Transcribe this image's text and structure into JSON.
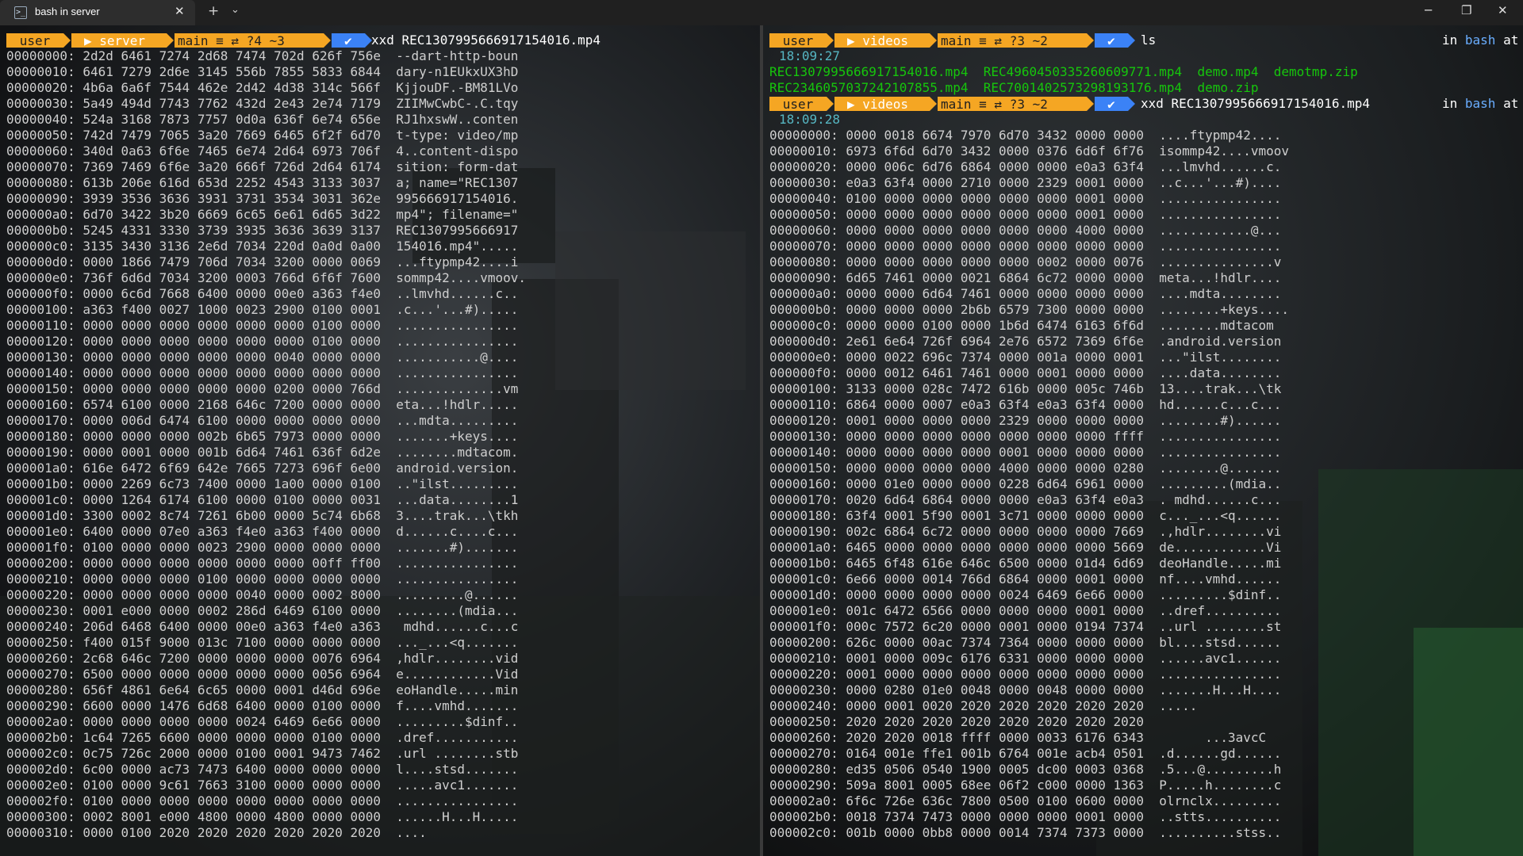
{
  "window": {
    "tab_title": "bash in server",
    "new_tab_glyph": "+",
    "tab_menu_glyph": "⌄",
    "tab_close_glyph": "✕",
    "minimize_glyph": "─",
    "maximize_glyph": "❐",
    "close_glyph": "✕"
  },
  "left": {
    "prompt": {
      "user": "user",
      "folder": "server",
      "git": "main ≡ ⇄ ?4 ~3",
      "check": "✔",
      "command": "xxd REC1307995666917154016.mp4"
    },
    "lines": [
      "00000000: 2d2d 6461 7274 2d68 7474 702d 626f 756e  --dart-http-boun",
      "00000010: 6461 7279 2d6e 3145 556b 7855 5833 6844  dary-n1EUkxUX3hD",
      "00000020: 4b6a 6a6f 7544 462e 2d42 4d38 314c 566f  KjjouDF.-BM81LVo",
      "00000030: 5a49 494d 7743 7762 432d 2e43 2e74 7179  ZIIMwCwbC-.C.tqy",
      "00000040: 524a 3168 7873 7757 0d0a 636f 6e74 656e  RJ1hxswW..conten",
      "00000050: 742d 7479 7065 3a20 7669 6465 6f2f 6d70  t-type: video/mp",
      "00000060: 340d 0a63 6f6e 7465 6e74 2d64 6973 706f  4..content-dispo",
      "00000070: 7369 7469 6f6e 3a20 666f 726d 2d64 6174  sition: form-dat",
      "00000080: 613b 206e 616d 653d 2252 4543 3133 3037  a; name=\"REC1307",
      "00000090: 3939 3536 3636 3931 3731 3534 3031 362e  995666917154016.",
      "000000a0: 6d70 3422 3b20 6669 6c65 6e61 6d65 3d22  mp4\"; filename=\"",
      "000000b0: 5245 4331 3330 3739 3935 3636 3639 3137  REC1307995666917",
      "000000c0: 3135 3430 3136 2e6d 7034 220d 0a0d 0a00  154016.mp4\".....",
      "000000d0: 0000 1866 7479 706d 7034 3200 0000 0069  ...ftypmp42....i",
      "000000e0: 736f 6d6d 7034 3200 0003 766d 6f6f 7600  sommp42....vmoov.",
      "000000f0: 0000 6c6d 7668 6400 0000 00e0 a363 f4e0  ..lmvhd......c..",
      "00000100: a363 f400 0027 1000 0023 2900 0100 0001  .c...'...#).....",
      "00000110: 0000 0000 0000 0000 0000 0000 0100 0000  ................",
      "00000120: 0000 0000 0000 0000 0000 0000 0100 0000  ................",
      "00000130: 0000 0000 0000 0000 0000 0040 0000 0000  ...........@....",
      "00000140: 0000 0000 0000 0000 0000 0000 0000 0000  ................",
      "00000150: 0000 0000 0000 0000 0000 0200 0000 766d  ..............vm",
      "00000160: 6574 6100 0000 2168 646c 7200 0000 0000  eta...!hdlr.....",
      "00000170: 0000 006d 6474 6100 0000 0000 0000 0000  ...mdta.........",
      "00000180: 0000 0000 0000 002b 6b65 7973 0000 0000  .......+keys....",
      "00000190: 0000 0001 0000 001b 6d64 7461 636f 6d2e  ........mdtacom.",
      "000001a0: 616e 6472 6f69 642e 7665 7273 696f 6e00  android.version.",
      "000001b0: 0000 2269 6c73 7400 0000 1a00 0000 0100  ..\"ilst.........",
      "000001c0: 0000 1264 6174 6100 0000 0100 0000 0031  ...data........1",
      "000001d0: 3300 0002 8c74 7261 6b00 0000 5c74 6b68  3....trak...\\tkh",
      "000001e0: 6400 0000 07e0 a363 f4e0 a363 f400 0000  d......c....c...",
      "000001f0: 0100 0000 0000 0023 2900 0000 0000 0000  .......#).......",
      "00000200: 0000 0000 0000 0000 0000 0000 00ff ff00  ................",
      "00000210: 0000 0000 0000 0100 0000 0000 0000 0000  ................",
      "00000220: 0000 0000 0000 0000 0040 0000 0002 8000  .........@......",
      "00000230: 0001 e000 0000 0002 286d 6469 6100 0000  ........(mdia...",
      "00000240: 206d 6468 6400 0000 00e0 a363 f4e0 a363   mdhd......c...c",
      "00000250: f400 015f 9000 013c 7100 0000 0000 0000  ..._...<q.......",
      "00000260: 2c68 646c 7200 0000 0000 0000 0076 6964  ,hdlr........vid",
      "00000270: 6500 0000 0000 0000 0000 0000 0056 6964  e............Vid",
      "00000280: 656f 4861 6e64 6c65 0000 0001 d46d 696e  eoHandle.....min",
      "00000290: 6600 0000 1476 6d68 6400 0000 0100 0000  f....vmhd.......",
      "000002a0: 0000 0000 0000 0000 0024 6469 6e66 0000  .........$dinf..",
      "000002b0: 1c64 7265 6600 0000 0000 0000 0100 0000  .dref...........",
      "000002c0: 0c75 726c 2000 0000 0100 0001 9473 7462  .url ........stb",
      "000002d0: 6c00 0000 ac73 7473 6400 0000 0000 0000  l....stsd.......",
      "000002e0: 0100 0000 9c61 7663 3100 0000 0000 0000  .....avc1.......",
      "000002f0: 0100 0000 0000 0000 0000 0000 0000 0000  ................",
      "00000300: 0002 8001 e000 4800 0000 4800 0000 0000  ......H...H.....",
      "00000310: 0000 0100 2020 2020 2020 2020 2020 2020  ...."
    ]
  },
  "right": {
    "prompt1": {
      "user": "user",
      "folder": "videos",
      "git": "main ≡ ⇄ ?3 ~2",
      "check": "✔",
      "command": "ls",
      "status_prefix": "in",
      "status_shell": "bash",
      "status_suffix": "at"
    },
    "time1": "18:09:27",
    "files_row1": "REC1307995666917154016.mp4  REC4960450335260609771.mp4  demo.mp4  demotmp.zip",
    "files_row2": "REC2346057037242107855.mp4  REC7001402573298193176.mp4  demo.zip",
    "prompt2": {
      "user": "user",
      "folder": "videos",
      "git": "main ≡ ⇄ ?3 ~2",
      "check": "✔",
      "command": "xxd REC1307995666917154016.mp4",
      "status_prefix": "in",
      "status_shell": "bash",
      "status_suffix": "at"
    },
    "time2": "18:09:28",
    "lines": [
      "00000000: 0000 0018 6674 7970 6d70 3432 0000 0000  ....ftypmp42....",
      "00000010: 6973 6f6d 6d70 3432 0000 0376 6d6f 6f76  isommp42....vmoov",
      "00000020: 0000 006c 6d76 6864 0000 0000 e0a3 63f4  ...lmvhd......c.",
      "00000030: e0a3 63f4 0000 2710 0000 2329 0001 0000  ..c...'...#)....",
      "00000040: 0100 0000 0000 0000 0000 0000 0001 0000  ................",
      "00000050: 0000 0000 0000 0000 0000 0000 0001 0000  ................",
      "00000060: 0000 0000 0000 0000 0000 0000 4000 0000  ............@...",
      "00000070: 0000 0000 0000 0000 0000 0000 0000 0000  ................",
      "00000080: 0000 0000 0000 0000 0000 0002 0000 0076  ...............v",
      "00000090: 6d65 7461 0000 0021 6864 6c72 0000 0000  meta...!hdlr....",
      "000000a0: 0000 0000 6d64 7461 0000 0000 0000 0000  ....mdta........",
      "000000b0: 0000 0000 0000 2b6b 6579 7300 0000 0000  ........+keys....",
      "000000c0: 0000 0000 0100 0000 1b6d 6474 6163 6f6d  ........mdtacom",
      "000000d0: 2e61 6e64 726f 6964 2e76 6572 7369 6f6e  .android.version",
      "000000e0: 0000 0022 696c 7374 0000 001a 0000 0001  ...\"ilst........",
      "000000f0: 0000 0012 6461 7461 0000 0001 0000 0000  ....data........",
      "00000100: 3133 0000 028c 7472 616b 0000 005c 746b  13....trak...\\tk",
      "00000110: 6864 0000 0007 e0a3 63f4 e0a3 63f4 0000  hd......c...c...",
      "00000120: 0001 0000 0000 0000 2329 0000 0000 0000  ........#)......",
      "00000130: 0000 0000 0000 0000 0000 0000 0000 ffff  ................",
      "00000140: 0000 0000 0000 0000 0001 0000 0000 0000  ................",
      "00000150: 0000 0000 0000 0000 4000 0000 0000 0280  ........@.......",
      "00000160: 0000 01e0 0000 0000 0228 6d64 6961 0000  .........(mdia..",
      "00000170: 0020 6d64 6864 0000 0000 e0a3 63f4 e0a3  . mdhd......c...",
      "00000180: 63f4 0001 5f90 0001 3c71 0000 0000 0000  c..._...<q......",
      "00000190: 002c 6864 6c72 0000 0000 0000 0000 7669  .,hdlr........vi",
      "000001a0: 6465 0000 0000 0000 0000 0000 0000 5669  de............Vi",
      "000001b0: 6465 6f48 616e 646c 6500 0000 01d4 6d69  deoHandle.....mi",
      "000001c0: 6e66 0000 0014 766d 6864 0000 0001 0000  nf....vmhd......",
      "000001d0: 0000 0000 0000 0000 0024 6469 6e66 0000  .........$dinf..",
      "000001e0: 001c 6472 6566 0000 0000 0000 0001 0000  ..dref..........",
      "000001f0: 000c 7572 6c20 0000 0001 0000 0194 7374  ..url ........st",
      "00000200: 626c 0000 00ac 7374 7364 0000 0000 0000  bl....stsd......",
      "00000210: 0001 0000 009c 6176 6331 0000 0000 0000  ......avc1......",
      "00000220: 0001 0000 0000 0000 0000 0000 0000 0000  ................",
      "00000230: 0000 0280 01e0 0048 0000 0048 0000 0000  .......H...H....",
      "00000240: 0000 0001 0020 2020 2020 2020 2020 2020  .....",
      "00000250: 2020 2020 2020 2020 2020 2020 2020 2020  ",
      "00000260: 2020 2020 0018 ffff 0000 0033 6176 6343        ...3avcC",
      "00000270: 0164 001e ffe1 001b 6764 001e acb4 0501  .d......gd......",
      "00000280: ed35 0506 0540 1900 0005 dc00 0003 0368  .5...@.........h",
      "00000290: 509a 8001 0005 68ee 06f2 c000 0000 1363  P.....h........c",
      "000002a0: 6f6c 726e 636c 7800 0500 0100 0600 0000  olrnclx.........",
      "000002b0: 0018 7374 7473 0000 0000 0000 0001 0000  ..stts..........",
      "000002c0: 001b 0000 0bb8 0000 0014 7374 7373 0000  ..........stss.."
    ]
  },
  "colors": {
    "prompt_orange": "#f5a623",
    "folder_orange": "#f5a623",
    "git_orange": "#f5a623",
    "check_blue": "#3b82f6",
    "time_cyan": "#56b6c2",
    "ls_green": "#16c60c",
    "keyword_blue": "#6aaeff"
  }
}
